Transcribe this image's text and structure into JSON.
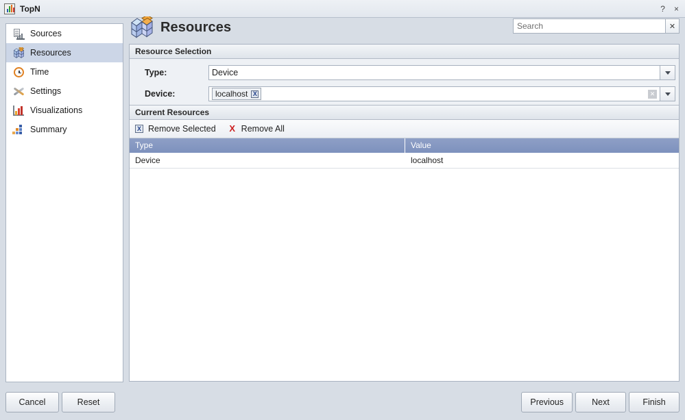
{
  "window": {
    "title": "TopN",
    "icon": "chart-icon",
    "help_label": "?",
    "close_label": "×"
  },
  "sidebar": {
    "items": [
      {
        "label": "Sources",
        "icon": "sources-icon",
        "selected": false
      },
      {
        "label": "Resources",
        "icon": "resources-cube-icon",
        "selected": true
      },
      {
        "label": "Time",
        "icon": "clock-icon",
        "selected": false
      },
      {
        "label": "Settings",
        "icon": "tools-icon",
        "selected": false
      },
      {
        "label": "Visualizations",
        "icon": "bar-chart-icon",
        "selected": false
      },
      {
        "label": "Summary",
        "icon": "summary-icon",
        "selected": false
      }
    ]
  },
  "header": {
    "title": "Resources",
    "icon": "resources-cube-icon"
  },
  "search": {
    "value": "",
    "placeholder": "Search",
    "clear_label": "✕"
  },
  "resource_selection": {
    "section_title": "Resource Selection",
    "type_field": {
      "label": "Type:",
      "value": "Device"
    },
    "device_field": {
      "label": "Device:",
      "chip_value": "localhost",
      "chip_remove_label": "X",
      "clear_label": "✕"
    }
  },
  "current_resources": {
    "section_title": "Current Resources",
    "toolbar": {
      "remove_selected_label": "Remove Selected",
      "remove_selected_icon": "X",
      "remove_all_label": "Remove All",
      "remove_all_icon": "X"
    },
    "table": {
      "columns": [
        "Type",
        "Value"
      ],
      "rows": [
        {
          "type": "Device",
          "value": "localhost"
        }
      ]
    }
  },
  "footer": {
    "cancel_label": "Cancel",
    "reset_label": "Reset",
    "previous_label": "Previous",
    "next_label": "Next",
    "finish_label": "Finish"
  },
  "colors": {
    "window_bg": "#d7dde5",
    "panel_bg": "#ffffff",
    "sidebar_selected": "#ccd6e7",
    "table_header": "#7d91bd",
    "field_area": "#eef1f5",
    "border": "#a9b3c1",
    "remove_all_red": "#cc1f1f"
  }
}
